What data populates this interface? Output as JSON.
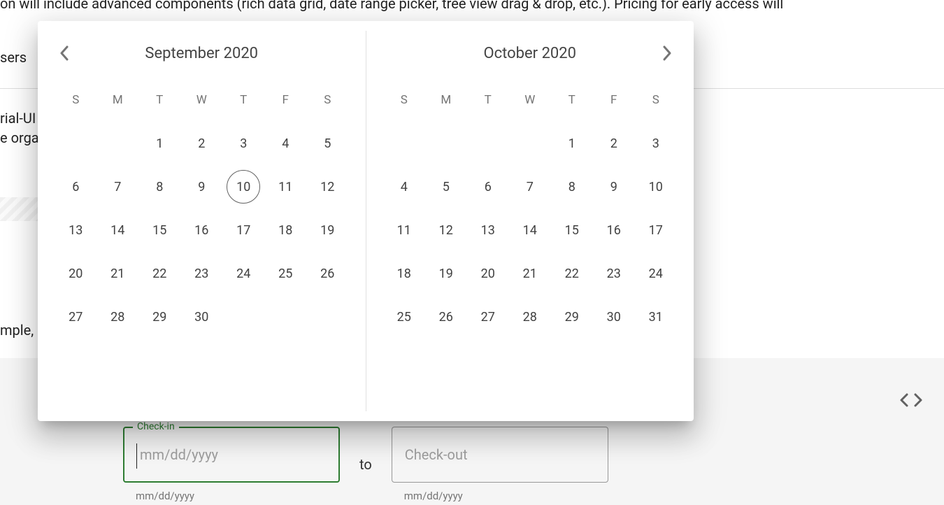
{
  "background": {
    "line_top": "on will include advanced components (rich data grid, date range picker, tree view drag & drop, etc.). Pricing for early access will",
    "line_users": "sers",
    "line_rial": "rial-UI",
    "line_orga": "e orga",
    "line_mple": "mple,"
  },
  "popup": {
    "dow": [
      "S",
      "M",
      "T",
      "W",
      "T",
      "F",
      "S"
    ],
    "months": [
      {
        "title": "September 2020",
        "startOffset": 2,
        "numDays": 30,
        "today": 10,
        "nav": "prev"
      },
      {
        "title": "October 2020",
        "startOffset": 4,
        "numDays": 31,
        "today": null,
        "nav": "next"
      }
    ]
  },
  "inputs": {
    "checkin_label": "Check-in",
    "checkin_placeholder": "mm/dd/yyyy",
    "checkin_helper": "mm/dd/yyyy",
    "to": "to",
    "checkout_placeholder": "Check-out",
    "checkout_helper": "mm/dd/yyyy"
  }
}
